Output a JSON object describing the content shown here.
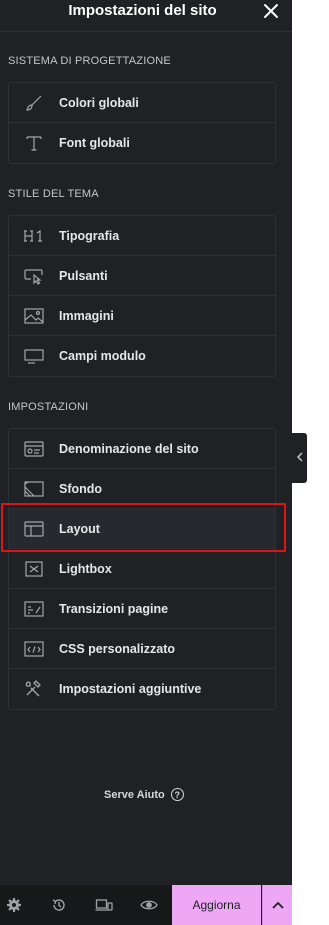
{
  "header": {
    "title": "Impostazioni del sito",
    "close_icon": "close-icon"
  },
  "sections": {
    "design_system": {
      "label": "Sistema di progettazione",
      "items": [
        {
          "label": "Colori globali",
          "icon": "brush-icon"
        },
        {
          "label": "Font globali",
          "icon": "font-icon"
        }
      ]
    },
    "theme_style": {
      "label": "Stile del tema",
      "items": [
        {
          "label": "Tipografia",
          "icon": "heading-icon"
        },
        {
          "label": "Pulsanti",
          "icon": "button-pointer-icon"
        },
        {
          "label": "Immagini",
          "icon": "image-icon"
        },
        {
          "label": "Campi modulo",
          "icon": "form-field-icon"
        }
      ]
    },
    "settings": {
      "label": "Impostazioni",
      "items": [
        {
          "label": "Denominazione del sito",
          "icon": "site-identity-icon"
        },
        {
          "label": "Sfondo",
          "icon": "background-icon"
        },
        {
          "label": "Layout",
          "icon": "layout-icon",
          "selected": true
        },
        {
          "label": "Lightbox",
          "icon": "lightbox-icon"
        },
        {
          "label": "Transizioni pagine",
          "icon": "page-transitions-icon"
        },
        {
          "label": "CSS personalizzato",
          "icon": "code-icon"
        },
        {
          "label": "Impostazioni aggiuntive",
          "icon": "tools-icon"
        }
      ]
    }
  },
  "help": {
    "label": "Serve Aiuto",
    "icon": "question-icon"
  },
  "footer": {
    "icons": [
      "settings-icon",
      "history-icon",
      "responsive-icon",
      "preview-icon"
    ],
    "publish_label": "Aggiorna",
    "publish_more_icon": "chevron-up-icon"
  },
  "colors": {
    "panel": "#1f2124",
    "accent": "#eda7f5",
    "highlight": "#d9151b"
  }
}
